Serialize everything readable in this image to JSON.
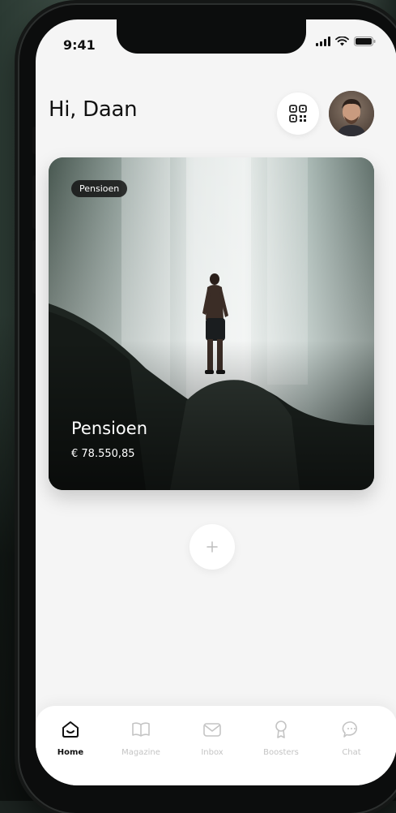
{
  "status": {
    "time": "9:41"
  },
  "header": {
    "greeting": "Hi, Daan"
  },
  "card": {
    "badge": "Pensioen",
    "title": "Pensioen",
    "amount": "€ 78.550,85"
  },
  "add_button": {
    "label": "+"
  },
  "tabs": [
    {
      "label": "Home",
      "icon": "home-icon",
      "active": true
    },
    {
      "label": "Magazine",
      "icon": "book-icon",
      "active": false
    },
    {
      "label": "Inbox",
      "icon": "mail-icon",
      "active": false
    },
    {
      "label": "Boosters",
      "icon": "award-icon",
      "active": false
    },
    {
      "label": "Chat",
      "icon": "chat-bubble-icon",
      "active": false
    }
  ],
  "colors": {
    "screen_bg": "#f5f5f5",
    "active_tab": "#111111",
    "inactive_tab": "#c4c4c4"
  }
}
